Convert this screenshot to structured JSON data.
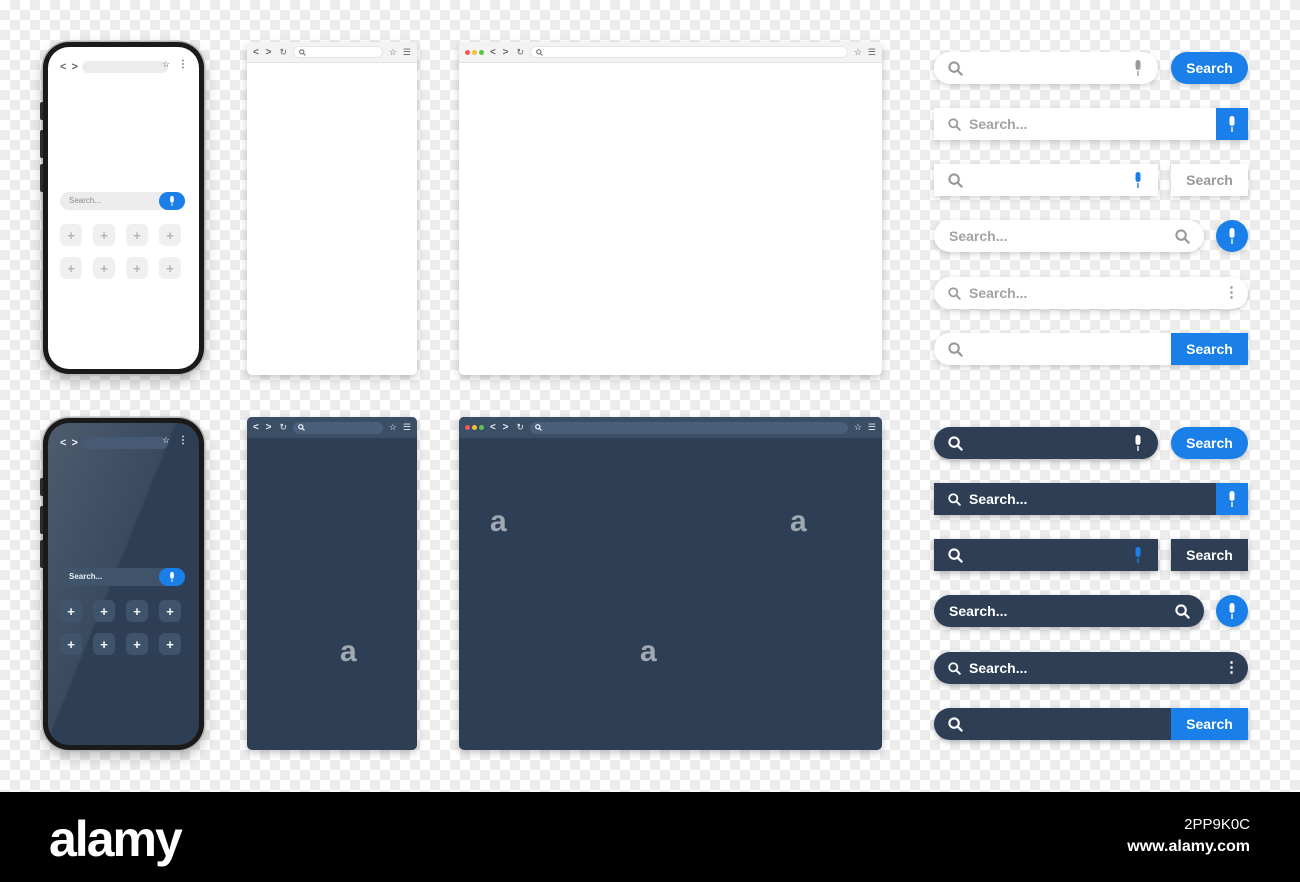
{
  "phone": {
    "search_placeholder": "Search...",
    "nav": "< >",
    "tile_glyph": "+"
  },
  "browser": {
    "nav": "< >"
  },
  "search_bars": {
    "search_label": "Search",
    "placeholder": "Search..."
  },
  "footer": {
    "logo": "alamy",
    "image_code": "2PP9K0C",
    "site": "www.alamy.com"
  },
  "colors": {
    "accent": "#1a7fe8",
    "dark_panel": "#2e3f55",
    "light_panel": "#ffffff"
  },
  "icons": [
    "search-icon",
    "mic-icon",
    "star-icon",
    "menu-icon",
    "reload-icon",
    "back-forward-icon",
    "more-vertical-icon",
    "plus-icon"
  ]
}
